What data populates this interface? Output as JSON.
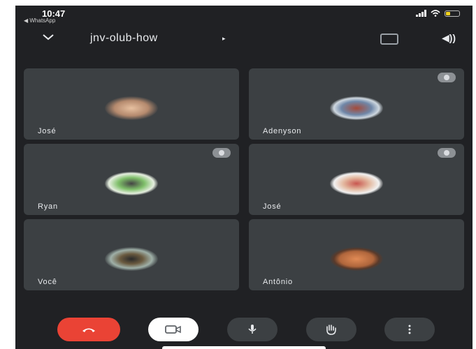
{
  "status_bar": {
    "time": "10:47",
    "back_app": "◀ WhatsApp"
  },
  "header": {
    "meeting_name": "jnv-olub-how",
    "arrow": "▸",
    "speaker_glyph": "◀))"
  },
  "participants": [
    {
      "name": "José",
      "muted": false,
      "avatar_color": "#b58a6e"
    },
    {
      "name": "Adenyson",
      "muted": true,
      "avatar_color": "#6f87a8"
    },
    {
      "name": "Ryan",
      "muted": true,
      "avatar_color": "#7fbf6a"
    },
    {
      "name": "José",
      "muted": true,
      "avatar_color": "#c8564f"
    },
    {
      "name": "Você",
      "muted": false,
      "avatar_color": "#6a5a3f"
    },
    {
      "name": "Antônio",
      "muted": false,
      "avatar_color": "#b0663c"
    }
  ],
  "controls": {
    "end_call": "phone-hangup-icon",
    "camera": "camera-icon",
    "mic": "microphone-icon",
    "raise_hand": "hand-icon",
    "more": "more-vertical-icon"
  },
  "colors": {
    "background": "#202124",
    "tile": "#3c4043",
    "end_call": "#ea4335"
  }
}
